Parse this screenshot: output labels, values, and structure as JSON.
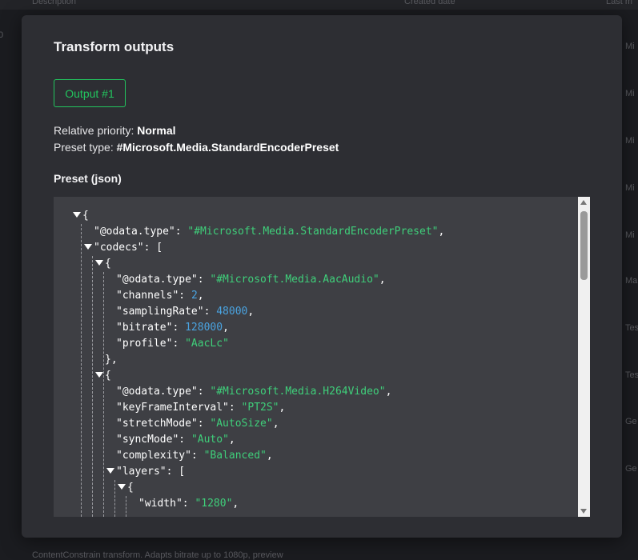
{
  "background": {
    "header_cols": [
      "Description",
      "Created date",
      "Last m"
    ],
    "row_prefixes": [
      "Mi",
      "Mi",
      "Mi",
      "Mi",
      "Mi",
      "Ma",
      "Tes",
      "Tes",
      "Ge",
      "Ge"
    ],
    "footer_text": "ContentConstrain transform. Adapts bitrate up to 1080p, preview"
  },
  "modal": {
    "title": "Transform outputs",
    "output_tab": "Output #1",
    "priority_label": "Relative priority:",
    "priority_value": "Normal",
    "preset_type_label": "Preset type:",
    "preset_type_value": "#Microsoft.Media.StandardEncoderPreset",
    "preset_json_title": "Preset (json)"
  },
  "json_lines": [
    {
      "d": 0,
      "tri": true,
      "k": "",
      "v": "{",
      "vt": "p",
      "c": ""
    },
    {
      "d": 1,
      "tri": false,
      "k": "@odata.type",
      "v": "\"#Microsoft.Media.StandardEncoderPreset\"",
      "vt": "s",
      "c": ","
    },
    {
      "d": 1,
      "tri": true,
      "k": "codecs",
      "v": "[",
      "vt": "p",
      "c": ""
    },
    {
      "d": 2,
      "tri": true,
      "k": "",
      "v": "{",
      "vt": "p",
      "c": ""
    },
    {
      "d": 3,
      "tri": false,
      "k": "@odata.type",
      "v": "\"#Microsoft.Media.AacAudio\"",
      "vt": "s",
      "c": ","
    },
    {
      "d": 3,
      "tri": false,
      "k": "channels",
      "v": "2",
      "vt": "n",
      "c": ","
    },
    {
      "d": 3,
      "tri": false,
      "k": "samplingRate",
      "v": "48000",
      "vt": "n",
      "c": ","
    },
    {
      "d": 3,
      "tri": false,
      "k": "bitrate",
      "v": "128000",
      "vt": "n",
      "c": ","
    },
    {
      "d": 3,
      "tri": false,
      "k": "profile",
      "v": "\"AacLc\"",
      "vt": "s",
      "c": ""
    },
    {
      "d": 2,
      "tri": false,
      "k": "",
      "v": "},",
      "vt": "p",
      "c": ""
    },
    {
      "d": 2,
      "tri": true,
      "k": "",
      "v": "{",
      "vt": "p",
      "c": ""
    },
    {
      "d": 3,
      "tri": false,
      "k": "@odata.type",
      "v": "\"#Microsoft.Media.H264Video\"",
      "vt": "s",
      "c": ","
    },
    {
      "d": 3,
      "tri": false,
      "k": "keyFrameInterval",
      "v": "\"PT2S\"",
      "vt": "s",
      "c": ","
    },
    {
      "d": 3,
      "tri": false,
      "k": "stretchMode",
      "v": "\"AutoSize\"",
      "vt": "s",
      "c": ","
    },
    {
      "d": 3,
      "tri": false,
      "k": "syncMode",
      "v": "\"Auto\"",
      "vt": "s",
      "c": ","
    },
    {
      "d": 3,
      "tri": false,
      "k": "complexity",
      "v": "\"Balanced\"",
      "vt": "s",
      "c": ","
    },
    {
      "d": 3,
      "tri": true,
      "k": "layers",
      "v": "[",
      "vt": "p",
      "c": ""
    },
    {
      "d": 4,
      "tri": true,
      "k": "",
      "v": "{",
      "vt": "p",
      "c": ""
    },
    {
      "d": 5,
      "tri": false,
      "k": "width",
      "v": "\"1280\"",
      "vt": "s",
      "c": ","
    }
  ],
  "colors": {
    "accent": "#22c55e",
    "string": "#3fcf7a",
    "number": "#4aa3e0"
  }
}
